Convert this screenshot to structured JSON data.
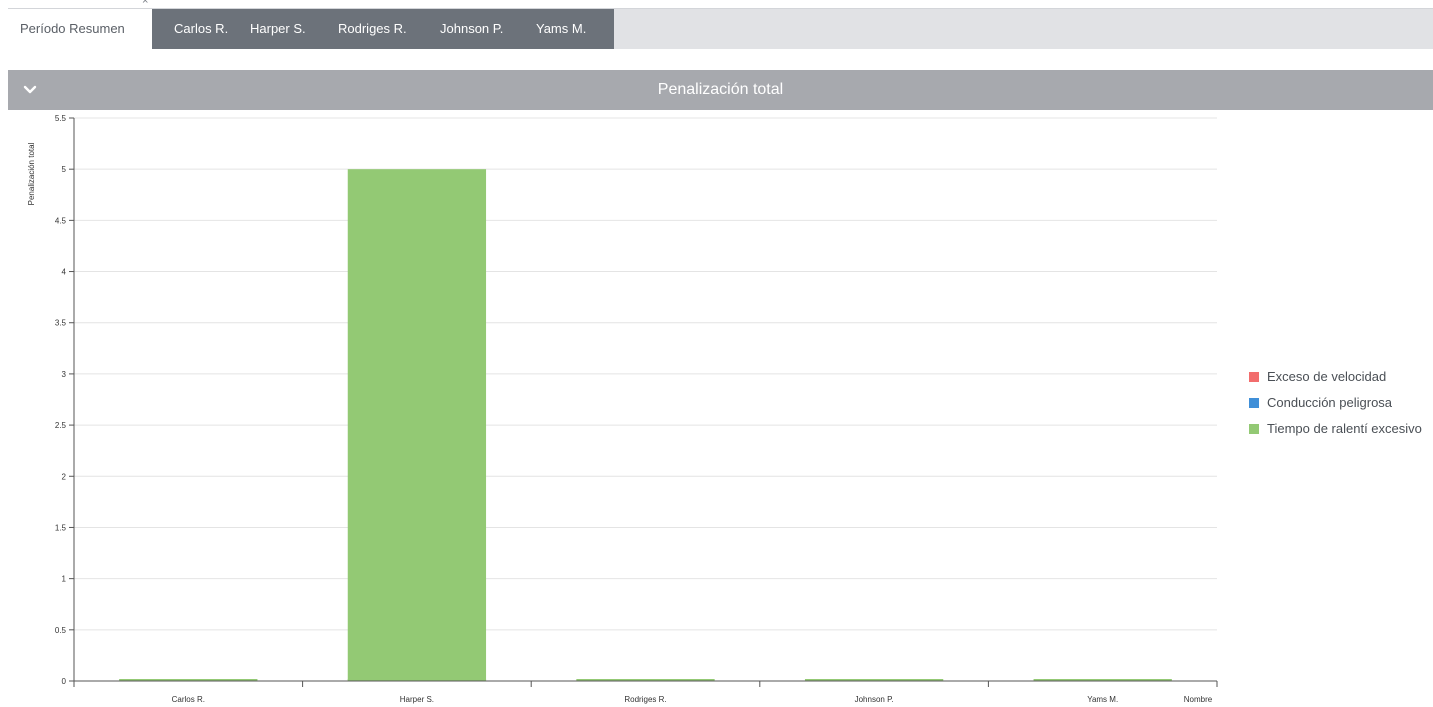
{
  "tabs": {
    "active": {
      "label": "Período Resumen",
      "close": "×"
    },
    "drivers": [
      {
        "label": "Carlos R.",
        "close": "×"
      },
      {
        "label": "Harper S.",
        "close": "×"
      },
      {
        "label": "Rodriges R.",
        "close": "×"
      },
      {
        "label": "Johnson P.",
        "close": "×"
      },
      {
        "label": "Yams M.",
        "close": "×"
      }
    ]
  },
  "panel": {
    "title": "Penalización total",
    "toggle_icon": "chevron-down-icon"
  },
  "colors": {
    "speeding": "#f26d6d",
    "dangerous": "#3f8fd8",
    "idle": "#93c974",
    "header_bg": "#a7a9ae",
    "tab_group_bg": "#6c727a"
  },
  "chart_data": {
    "type": "bar",
    "stacked": true,
    "title": "",
    "ylabel": "Penalización total",
    "xlabel": "Nombre",
    "categories": [
      "Carlos R.",
      "Harper S.",
      "Rodriges R.",
      "Johnson P.",
      "Yams M."
    ],
    "series": [
      {
        "name": "Exceso de velocidad",
        "color": "#f26d6d",
        "values": [
          0,
          0,
          0,
          0,
          0
        ]
      },
      {
        "name": "Conducción peligrosa",
        "color": "#3f8fd8",
        "values": [
          0,
          0,
          0,
          0,
          0
        ]
      },
      {
        "name": "Tiempo de ralentí excesivo",
        "color": "#93c974",
        "values": [
          0,
          5,
          0,
          0,
          0
        ]
      }
    ],
    "ylim": [
      0,
      5.5
    ],
    "yticks": [
      0,
      0.5,
      1,
      1.5,
      2,
      2.5,
      3,
      3.5,
      4,
      4.5,
      5,
      5.5
    ],
    "ytick_labels": [
      "0",
      "0.5",
      "1",
      "1.5",
      "2",
      "2.5",
      "3",
      "3.5",
      "4",
      "4.5",
      "5",
      "5.5"
    ],
    "grid": true,
    "legend_position": "right"
  }
}
